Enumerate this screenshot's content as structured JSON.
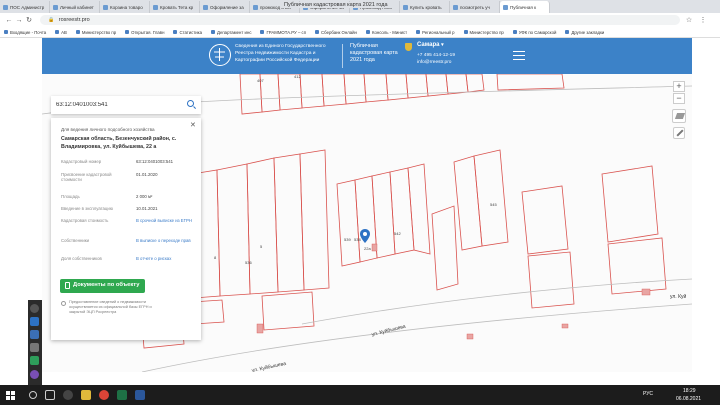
{
  "browser": {
    "tabs": [
      {
        "label": "ПОС Администр"
      },
      {
        "label": "Личный кабинет"
      },
      {
        "label": "Корзина товаро"
      },
      {
        "label": "Кровать Тета кр"
      },
      {
        "label": "Оформление за"
      },
      {
        "label": "промокод в аст"
      },
      {
        "label": "Оформление за"
      },
      {
        "label": "Промокод Аско"
      },
      {
        "label": "Купить кровать"
      },
      {
        "label": "посмотреть уч"
      },
      {
        "label": "Публичная к"
      }
    ],
    "url": "rosreestr.pro",
    "page_title": "Публичная кадастровая карта 2021 года",
    "bookmarks": [
      "Входящие - Почта",
      "AB",
      "Министерство пр",
      "Открытая. Главн",
      "Статистика",
      "Департамент инс",
      "ГРАММОТА.РУ – сп",
      "Сбербанк Онлайн",
      "Консоль - Минист",
      "Региональный р",
      "Министерство пр",
      "УФК по Самарской",
      "Другие закладки"
    ]
  },
  "header": {
    "org_text": "Сведения из Единого Государственного Реестра Недвижимости Кадастра и Картографии Российской Федерации",
    "map_title": "Публичная кадастровая карта 2021 года",
    "region": "Самара",
    "phone": "+7 495 414-12-19",
    "email": "info@rreestr.pro"
  },
  "search": {
    "value": "63:12:0401003:541"
  },
  "card": {
    "purpose": "Для ведения личного подсобного хозяйства",
    "address": "Самарская область, Безенчукский район, с. Владимировка, ул. Куйбышева, 22 а",
    "rows": [
      {
        "label": "Кадастровый номер",
        "value": "63:12:0401003:541",
        "link": false
      },
      {
        "label": "Присвоение кадастровой стоимости",
        "value": "01.01.2020",
        "link": false
      },
      {
        "label": "Площадь",
        "value": "2 000 м²",
        "link": false
      },
      {
        "label": "Введение в эксплуатацию",
        "value": "10.01.2021",
        "link": false
      },
      {
        "label": "Кадастровая стоимость",
        "value": "В срочной выписке из ЕГРН",
        "link": true
      },
      {
        "label": "Собственники",
        "value": "В выписке о переходе прав",
        "link": true
      },
      {
        "label": "Доля собственников",
        "value": "В отчете о рисках",
        "link": true
      }
    ],
    "docs_button": "Документы по объекту",
    "disclaimer": "Предоставление сведений о недвижимости осуществляется из официальной базы ЕГРН и закрытой ЭЦП Росреестра"
  },
  "map": {
    "street_top": "ул. Куй",
    "street_main": "ул. Куйбышева",
    "street_bottom": "ул. Куйбышева",
    "parcel_labels": [
      "412",
      "407",
      "545",
      "539",
      "542",
      "538",
      "536",
      "5",
      "8",
      "22а"
    ],
    "zoom_in": "+",
    "zoom_out": "−"
  },
  "taskbar": {
    "time": "18:29",
    "date": "06.08.2021",
    "lang": "РУС"
  },
  "colors": {
    "header_blue": "#3c82c8",
    "parcel_red": "#d9534f",
    "button_green": "#2fa84f",
    "link_blue": "#3a7bc8"
  }
}
